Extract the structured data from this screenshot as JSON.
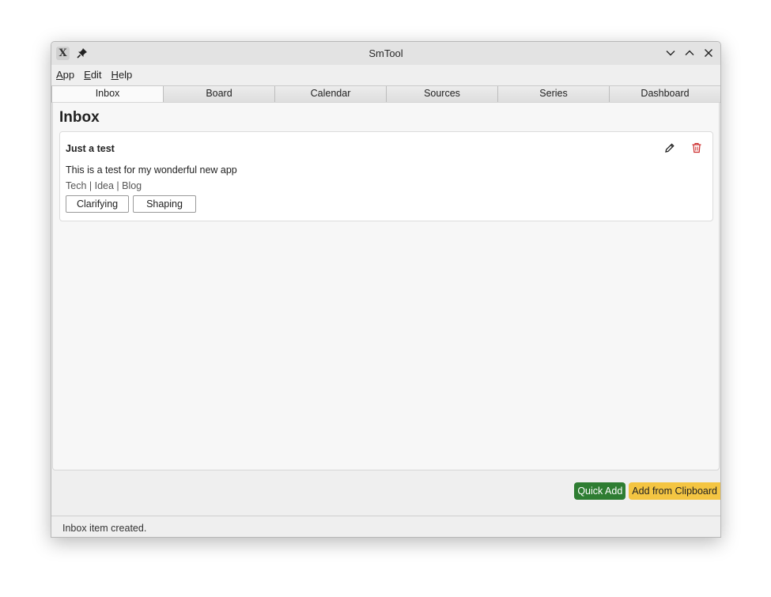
{
  "window": {
    "title": "SmTool",
    "app_icon_glyph": "X",
    "icons": [
      "app-icon",
      "pin-icon",
      "minimize-icon",
      "maximize-icon",
      "close-icon"
    ]
  },
  "menubar": {
    "items": [
      {
        "mnemonic": "A",
        "rest": "pp"
      },
      {
        "mnemonic": "E",
        "rest": "dit"
      },
      {
        "mnemonic": "H",
        "rest": "elp"
      }
    ]
  },
  "tabs": [
    {
      "label": "Inbox",
      "active": true
    },
    {
      "label": "Board",
      "active": false
    },
    {
      "label": "Calendar",
      "active": false
    },
    {
      "label": "Sources",
      "active": false
    },
    {
      "label": "Series",
      "active": false
    },
    {
      "label": "Dashboard",
      "active": false
    }
  ],
  "main": {
    "page_title": "Inbox",
    "items": [
      {
        "title": "Just a test",
        "description": "This is a test for my wonderful new app",
        "tags": "Tech | Idea | Blog",
        "buttons": [
          "Clarifying",
          "Shaping"
        ],
        "action_icons": [
          "edit-icon",
          "delete-icon"
        ]
      }
    ]
  },
  "actions": {
    "quick_add": "Quick Add",
    "add_from_clipboard": "Add from Clipboard"
  },
  "colors": {
    "quick_add_bg": "#2e7d32",
    "clipboard_bg": "#f4c542",
    "delete_icon": "#cc2a2a"
  },
  "status": {
    "text": "Inbox item created."
  }
}
